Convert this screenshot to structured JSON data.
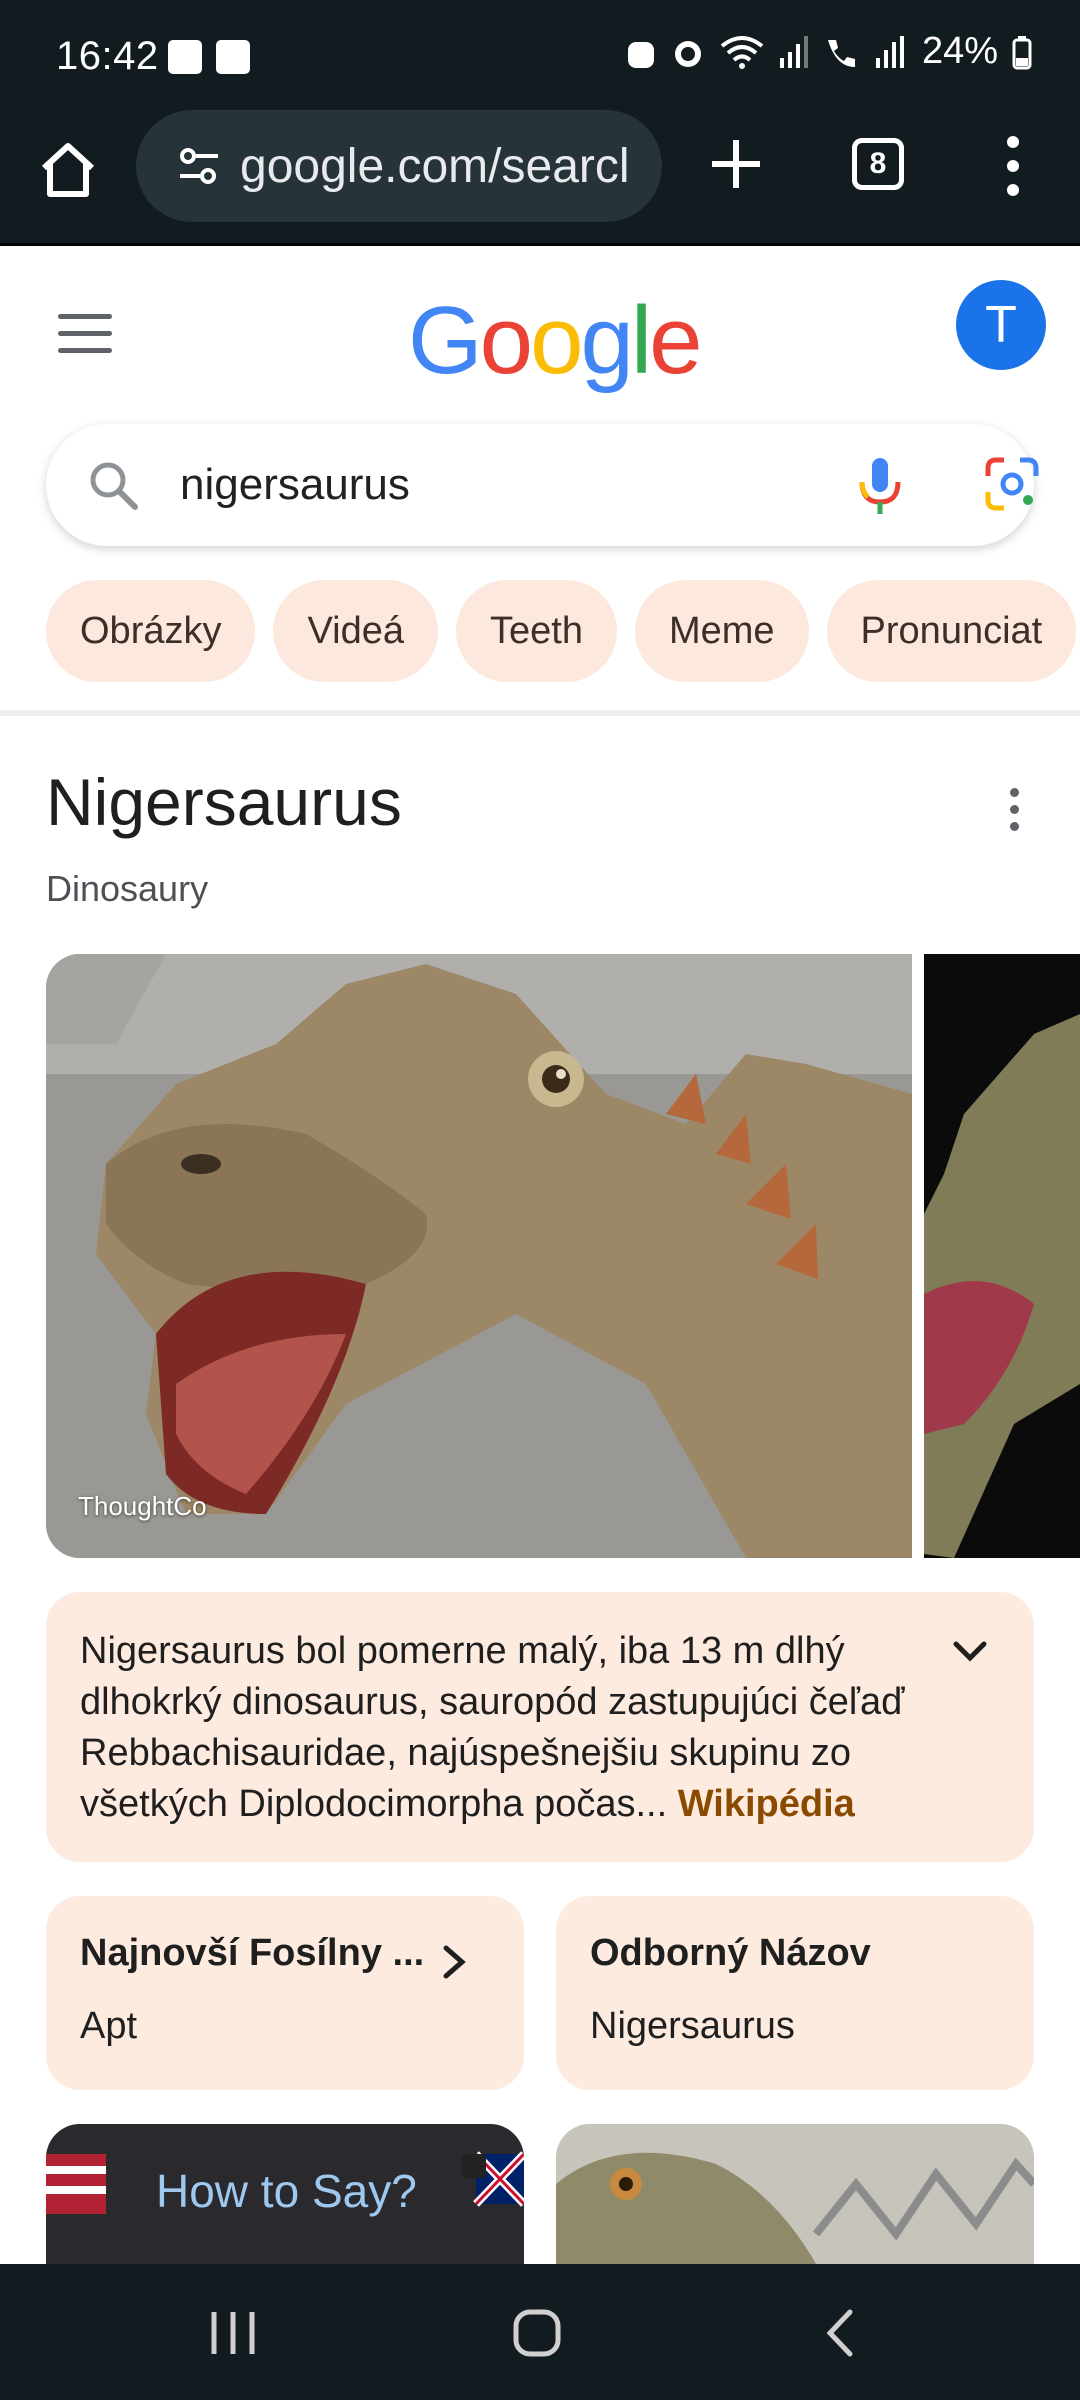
{
  "status": {
    "time": "16:42",
    "battery": "24%"
  },
  "browser": {
    "url": "google.com/searcl",
    "tab_count": "8"
  },
  "google": {
    "logo_letters": [
      "G",
      "o",
      "o",
      "g",
      "l",
      "e"
    ],
    "logo_colors": [
      "#4285F4",
      "#EA4335",
      "#FBBC05",
      "#4285F4",
      "#34A853",
      "#EA4335"
    ],
    "avatar_letter": "T",
    "query": "nigersaurus"
  },
  "chips": [
    "Obrázky",
    "Videá",
    "Teeth",
    "Meme",
    "Pronunciat"
  ],
  "knowledge": {
    "title": "Nigersaurus",
    "subtitle": "Dinosaury",
    "image_credit": "ThoughtCo",
    "description": "Nigersaurus bol pomerne malý, iba 13 m dlhý dlhokrký dinosaurus, sauropód zastupujúci čeľaď Rebbachisauridae, najúspešnejšiu skupinu zo všetkých Diplodocimorpha počas...",
    "source": "Wikipédia",
    "facts": [
      {
        "title": "Najnovší Fosílny ...",
        "value": "Apt"
      },
      {
        "title": "Odborný Názov",
        "value": "Nigersaurus"
      }
    ],
    "thumb_text": "How to Say?"
  },
  "colors": {
    "chip_bg": "#fce8dc",
    "card_bg": "#fdebdf",
    "accent": "#1a73e8",
    "bar_bg": "#121b1f"
  }
}
